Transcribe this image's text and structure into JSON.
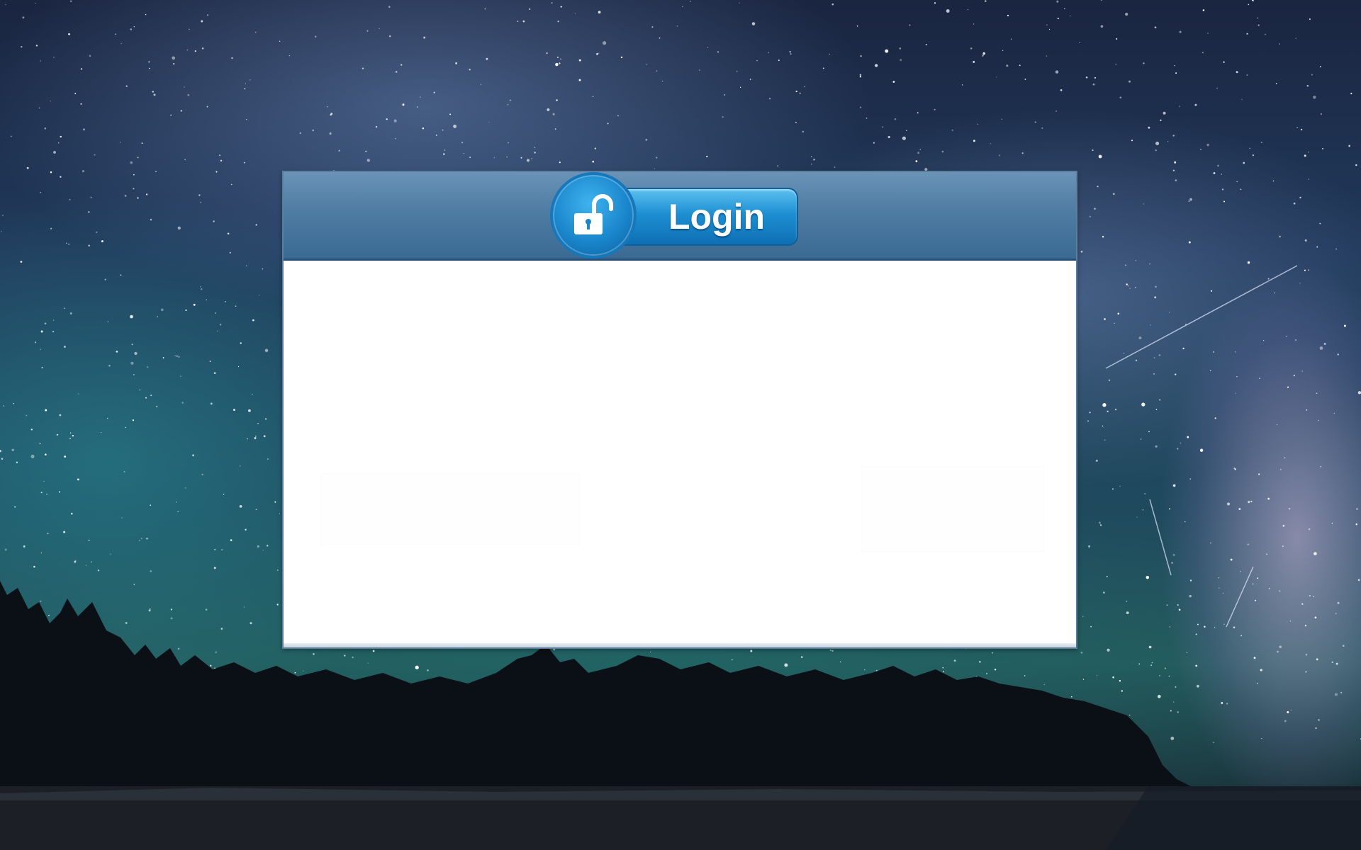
{
  "login_window": {
    "title_badge": {
      "label": "Login",
      "icon": "unlocked-padlock-icon"
    }
  },
  "colors": {
    "header": "#4f7ca3",
    "badge": "#1d8fd2",
    "body": "#ffffff"
  }
}
